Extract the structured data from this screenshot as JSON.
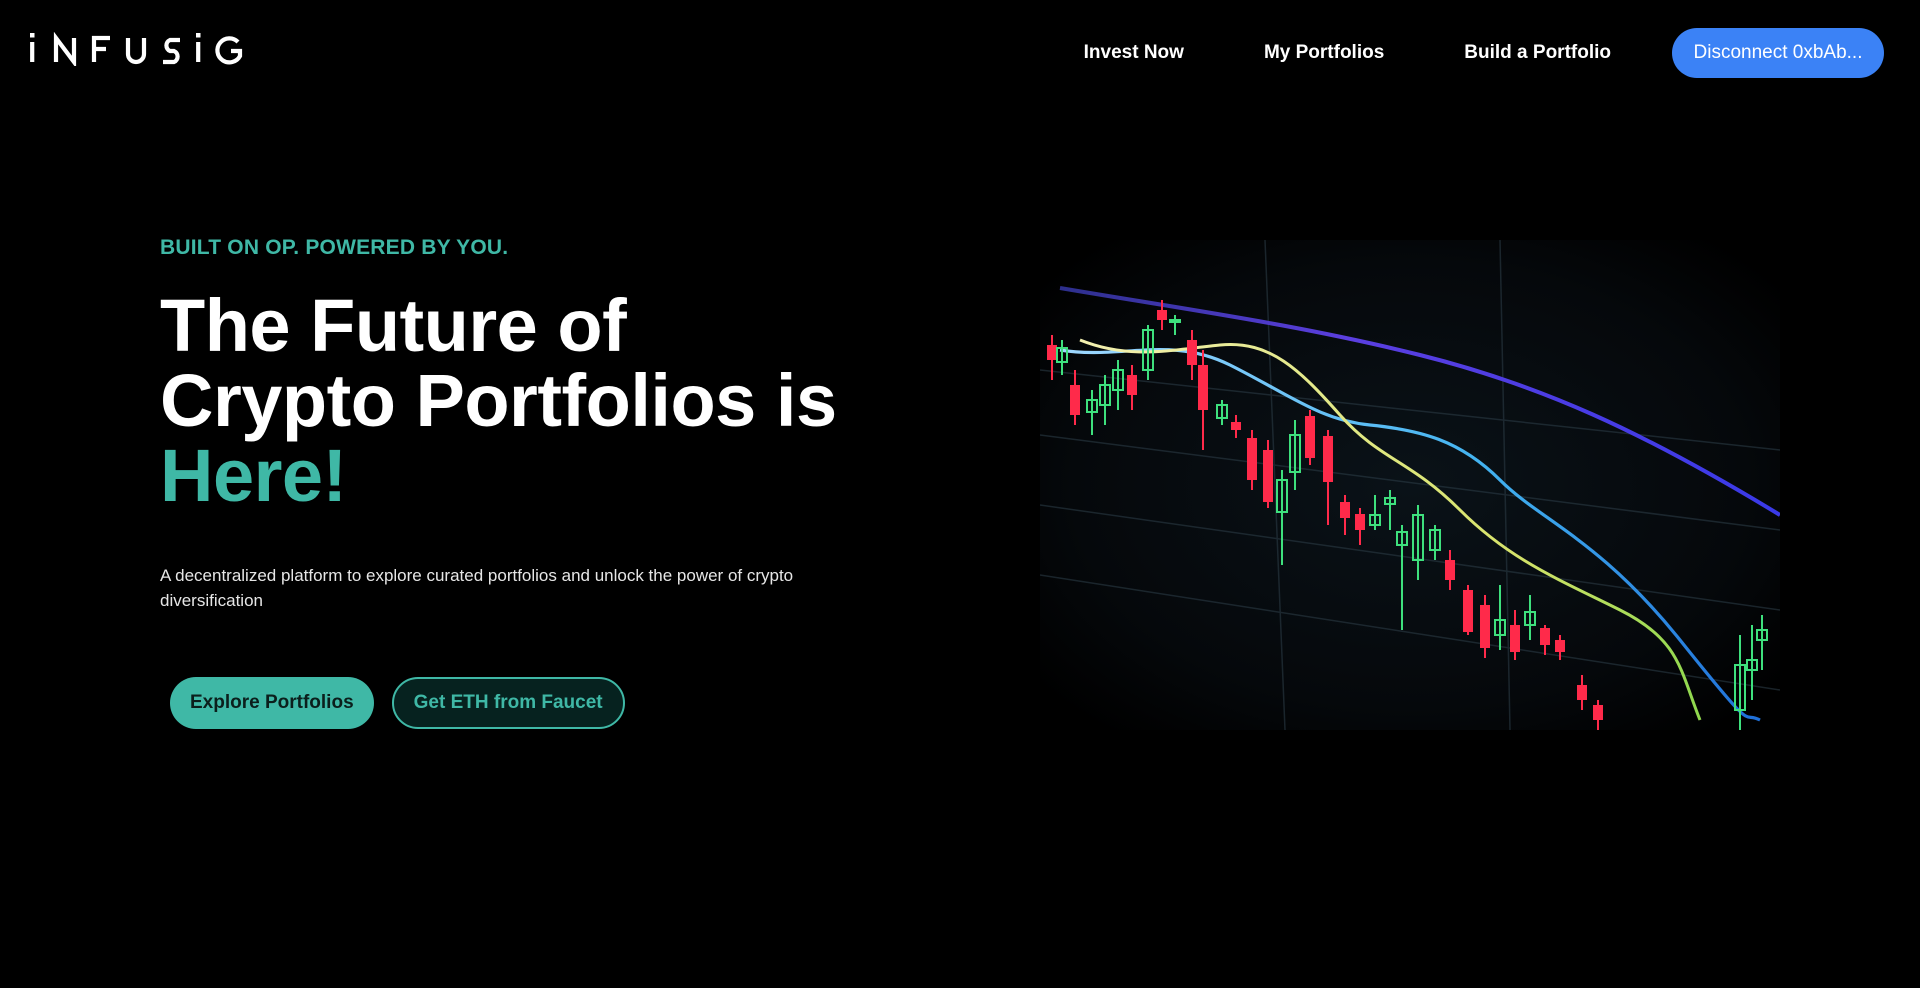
{
  "header": {
    "logo_text": "iNFUSiG",
    "nav": {
      "invest_now": "Invest Now",
      "my_portfolios": "My Portfolios",
      "build_portfolio": "Build a Portfolio"
    },
    "wallet_button": "Disconnect 0xbAb..."
  },
  "hero": {
    "eyebrow": "BUILT ON OP. POWERED BY YOU.",
    "headline_line1": "The Future of",
    "headline_line2": "Crypto Portfolios is",
    "headline_accent": "Here!",
    "subtitle": "A decentralized platform to explore curated portfolios and unlock the power of crypto diversification",
    "primary_button": "Explore Portfolios",
    "secondary_button": "Get ETH from Faucet",
    "image_icon": "candlestick-chart-image"
  },
  "colors": {
    "background": "#000000",
    "accent": "#3fb8a6",
    "wallet_button": "#3b82f6",
    "text": "#ffffff"
  }
}
